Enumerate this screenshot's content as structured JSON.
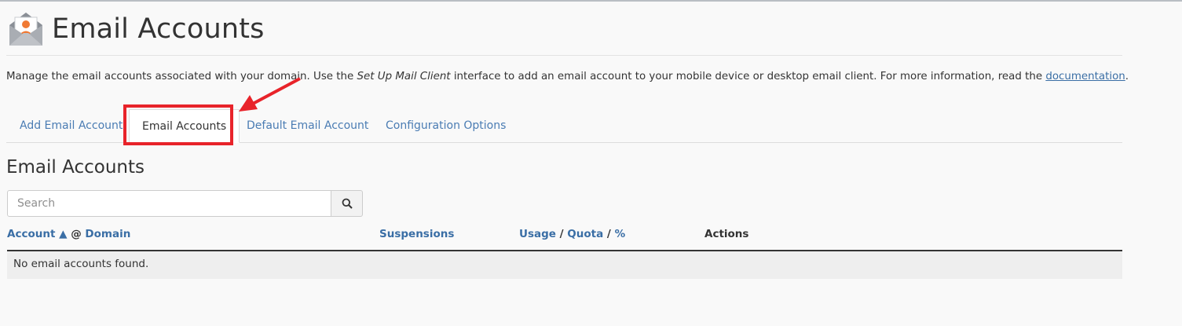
{
  "header": {
    "title": "Email Accounts"
  },
  "description": {
    "prefix": "Manage the email accounts associated with your domain. Use the ",
    "em_text": "Set Up Mail Client",
    "middle": " interface to add an email account to your mobile device or desktop email client. For more information, read the ",
    "link_text": "documentation",
    "suffix": "."
  },
  "tabs": [
    {
      "label": "Add Email Account",
      "active": false
    },
    {
      "label": "Email Accounts",
      "active": true
    },
    {
      "label": "Default Email Account",
      "active": false
    },
    {
      "label": "Configuration Options",
      "active": false
    }
  ],
  "section": {
    "title": "Email Accounts"
  },
  "search": {
    "placeholder": "Search",
    "value": "",
    "icon": "search-icon"
  },
  "table": {
    "headers": {
      "account": "Account",
      "sort_indicator": "▲",
      "at": "@",
      "domain": "Domain",
      "suspensions": "Suspensions",
      "usage": "Usage",
      "sep1": "/",
      "quota": "Quota",
      "sep2": "/",
      "percent": "%",
      "actions": "Actions"
    },
    "empty_message": "No email accounts found."
  },
  "annotation": {
    "color": "#e8232a"
  }
}
